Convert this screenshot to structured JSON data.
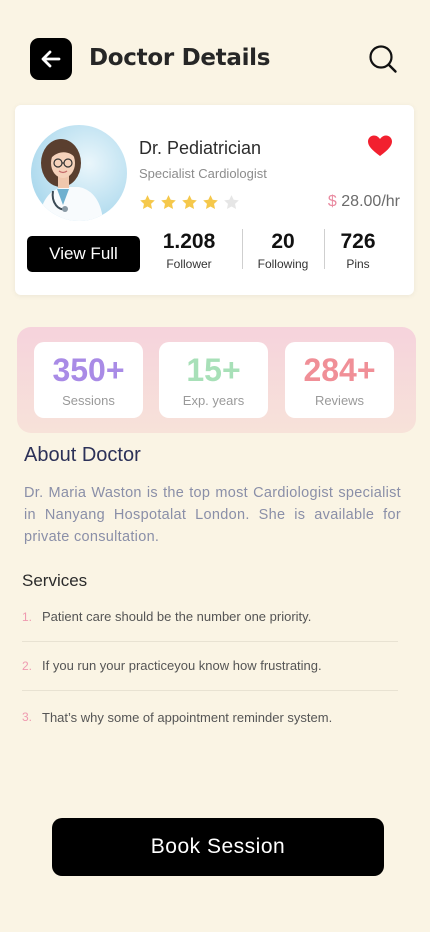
{
  "header": {
    "title": "Doctor Details",
    "back_icon": "arrow-left-icon",
    "search_icon": "search-icon"
  },
  "doctor": {
    "name": "Dr. Pediatrician",
    "specialty": "Specialist Cardiologist",
    "rating": 4,
    "rating_max": 5,
    "price_currency": "$",
    "price_value": "28.00/hr",
    "favorite": true,
    "view_label": "View Full",
    "stats": [
      {
        "value": "1.208",
        "label": "Follower"
      },
      {
        "value": "20",
        "label": "Following"
      },
      {
        "value": "726",
        "label": "Pins"
      }
    ]
  },
  "highlights": [
    {
      "value": "350+",
      "label": "Sessions",
      "color": "#a98be6"
    },
    {
      "value": "15+",
      "label": "Exp. years",
      "color": "#a8e0b8"
    },
    {
      "value": "284+",
      "label": "Reviews",
      "color": "#f08f97"
    }
  ],
  "about": {
    "title": "About Doctor",
    "text": "Dr. Maria Waston is the top most Cardiologist specialist in Nanyang Hospotalat London. She is available for private consultation."
  },
  "services": {
    "title": "Services",
    "items": [
      {
        "num": "1.",
        "text": "Patient care should be the number one priority."
      },
      {
        "num": "2.",
        "text": "If you run your practiceyou know how frustrating."
      },
      {
        "num": "3.",
        "text": "That’s why some of appointment reminder system."
      }
    ]
  },
  "cta": {
    "label": "Book Session"
  },
  "colors": {
    "background": "#faf4e4",
    "accent_pink": "#e98aa0",
    "star": "#f5c84b"
  }
}
